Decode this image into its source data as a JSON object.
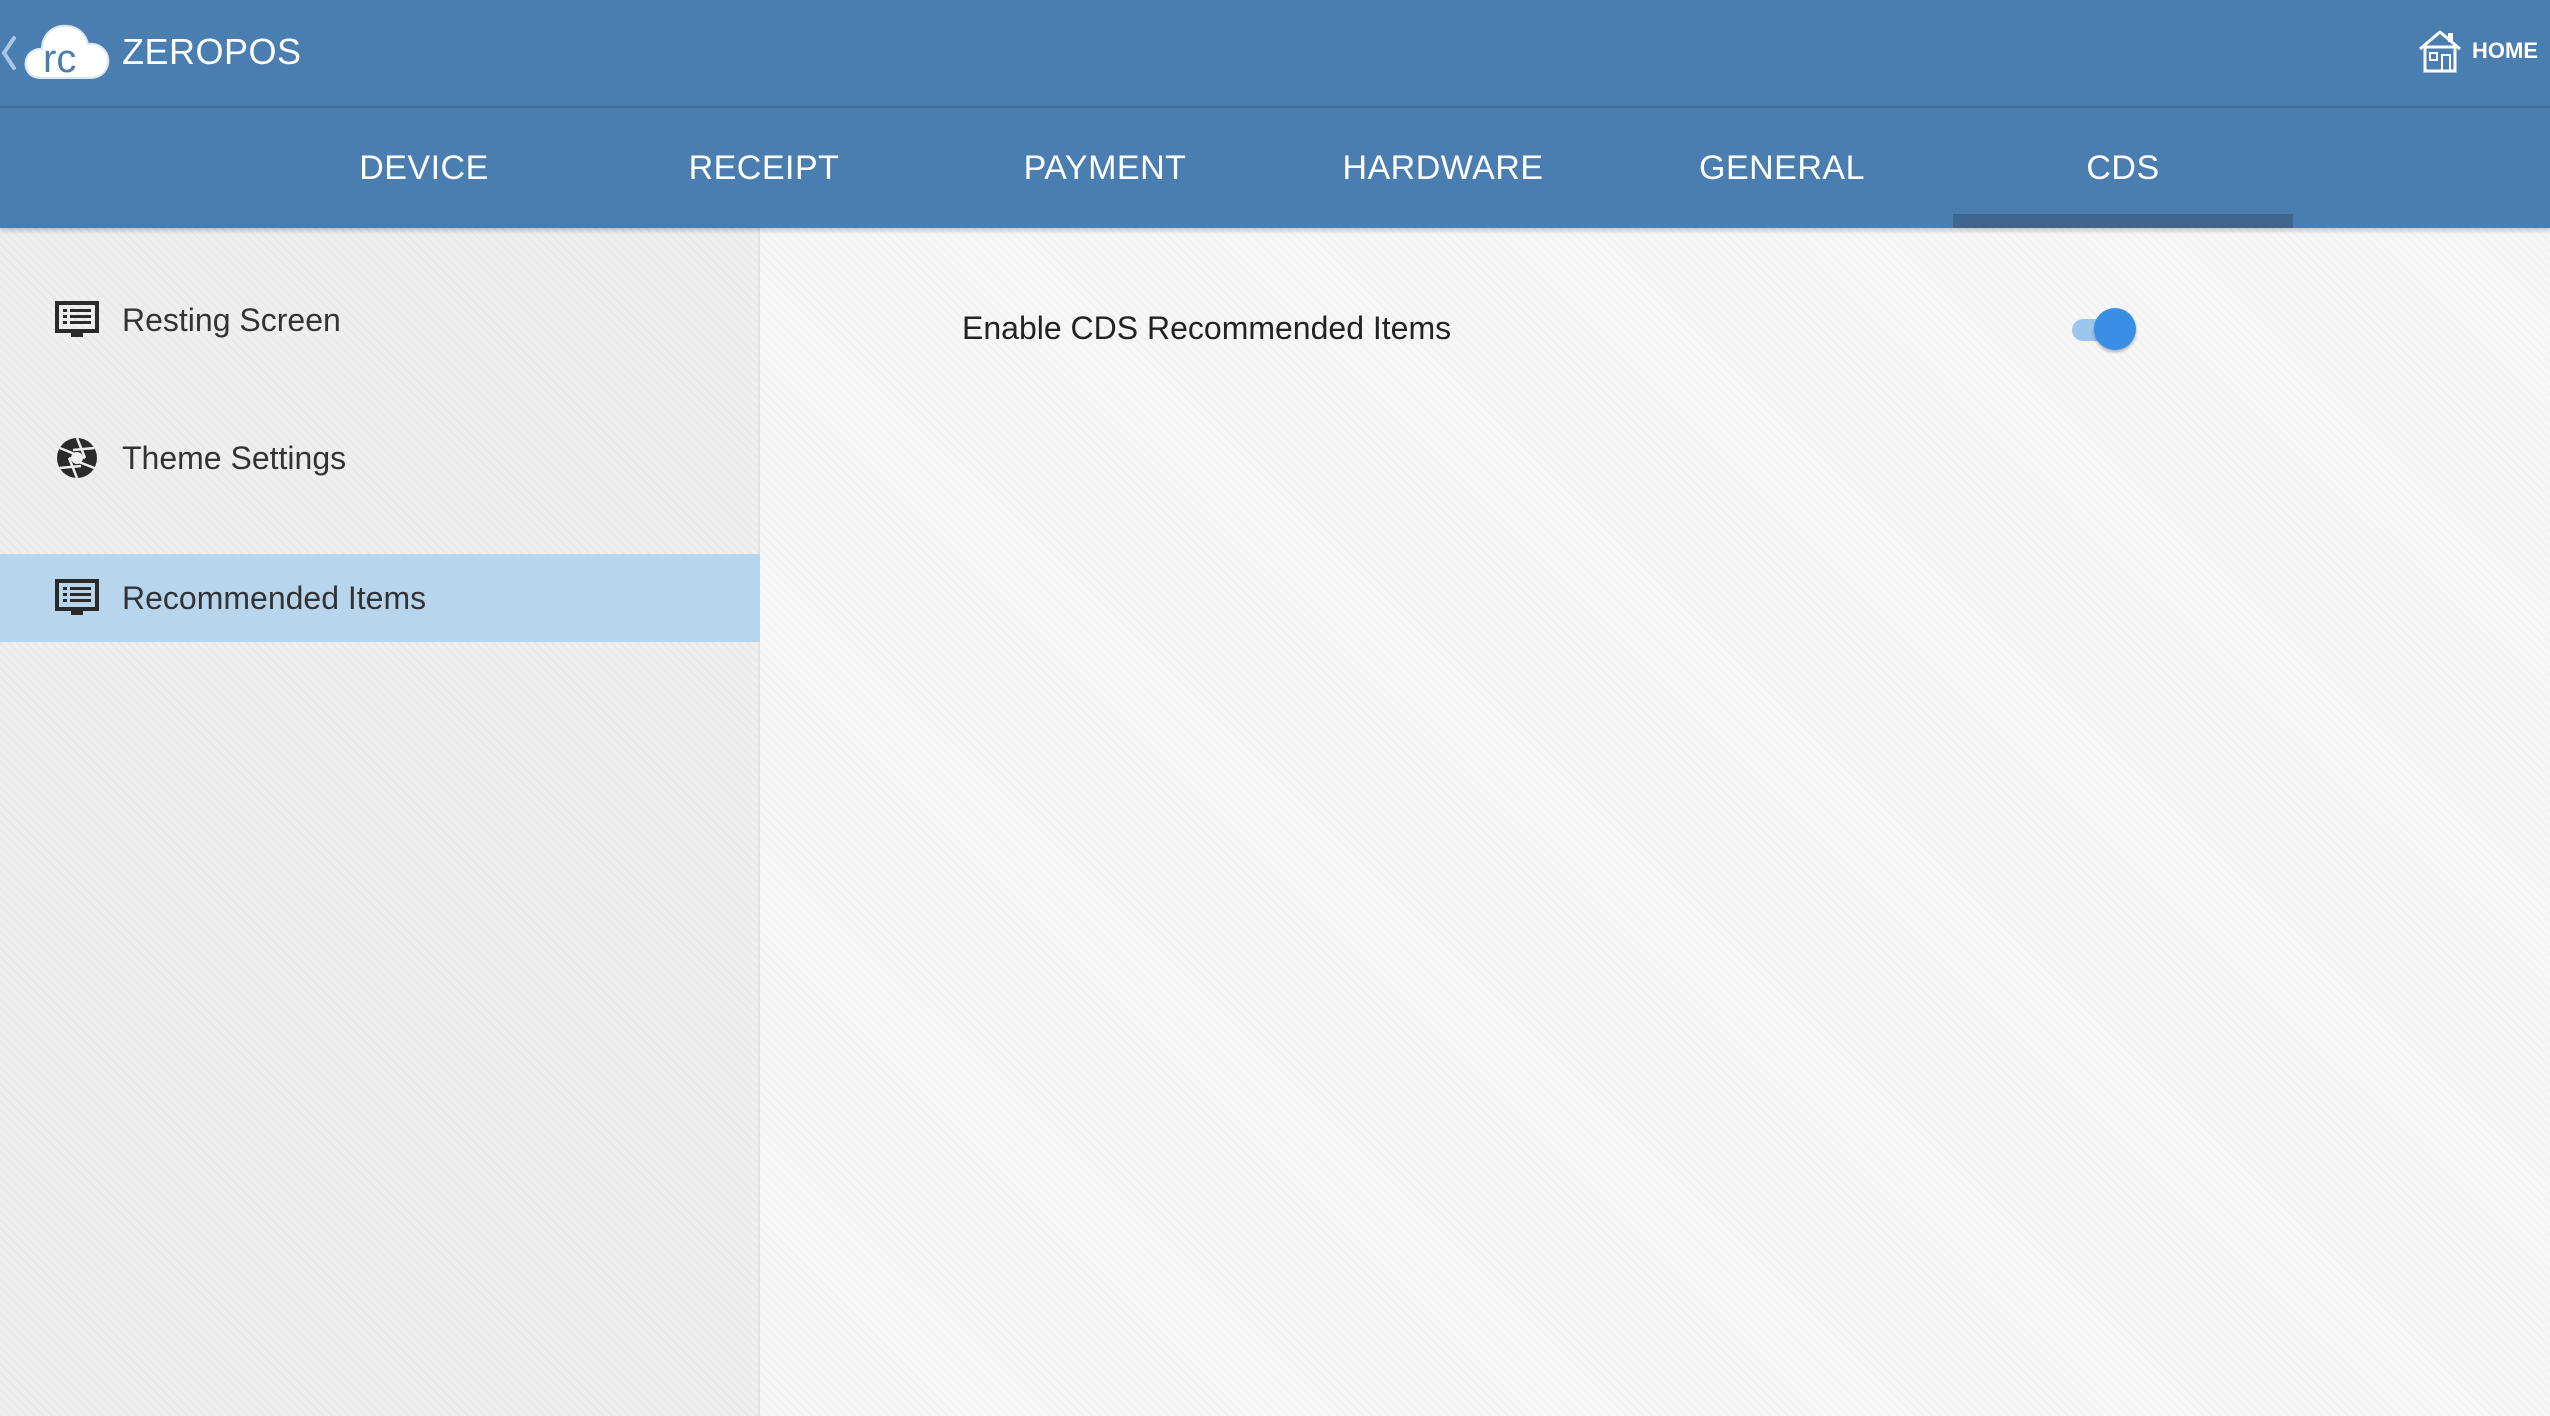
{
  "app": {
    "title": "ZEROPOS",
    "logo_text": "rc",
    "home_label": "HOME"
  },
  "tabs": [
    {
      "label": "DEVICE",
      "active": false
    },
    {
      "label": "RECEIPT",
      "active": false
    },
    {
      "label": "PAYMENT",
      "active": false
    },
    {
      "label": "HARDWARE",
      "active": false
    },
    {
      "label": "GENERAL",
      "active": false
    },
    {
      "label": "CDS",
      "active": true
    }
  ],
  "sidebar": {
    "items": [
      {
        "label": "Resting Screen",
        "icon": "list-screen-icon",
        "active": false
      },
      {
        "label": "Theme Settings",
        "icon": "aperture-icon",
        "active": false
      },
      {
        "label": "Recommended Items",
        "icon": "list-screen-icon",
        "active": true
      }
    ]
  },
  "content": {
    "setting": {
      "label": "Enable CDS Recommended Items",
      "enabled": true
    }
  },
  "colors": {
    "primary": "#4a7eb0",
    "tab_indicator": "#3e668f",
    "sidebar_active": "#b7d5ec",
    "toggle_on": "#3a8ee6"
  }
}
